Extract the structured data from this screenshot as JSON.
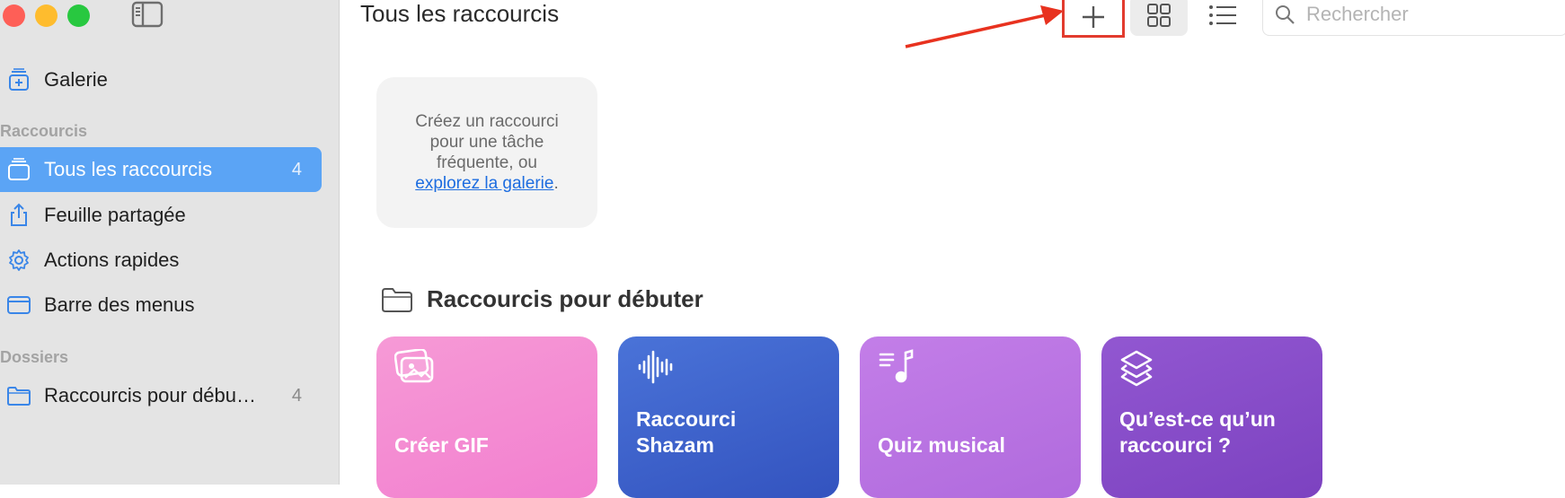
{
  "sidebar": {
    "gallery_label": "Galerie",
    "section_shortcuts": "Raccourcis",
    "section_folders": "Dossiers",
    "items": [
      {
        "label": "Tous les raccourcis",
        "count": "4"
      },
      {
        "label": "Feuille partagée",
        "count": ""
      },
      {
        "label": "Actions rapides",
        "count": ""
      },
      {
        "label": "Barre des menus",
        "count": ""
      }
    ],
    "folders": [
      {
        "label": "Raccourcis pour débu…",
        "count": "4"
      }
    ]
  },
  "header": {
    "title": "Tous les raccourcis",
    "search_placeholder": "Rechercher"
  },
  "empty_card": {
    "line1": "Créez un raccourci",
    "line2": "pour une tâche",
    "line3": "fréquente, ou",
    "link": "explorez la galerie",
    "suffix": "."
  },
  "starter_section": {
    "title": "Raccourcis pour débuter",
    "tiles": [
      {
        "name": "Créer GIF",
        "icon": "photos-icon"
      },
      {
        "name": "Raccourci\nShazam",
        "icon": "waveform-icon"
      },
      {
        "name": "Quiz musical",
        "icon": "music-list-icon"
      },
      {
        "name": "Qu’est-ce qu’un\nraccourci ?",
        "icon": "layers-icon"
      }
    ]
  },
  "colors": {
    "selected": "#5ba4f5",
    "highlight": "#e23b2e",
    "link": "#1d6de0",
    "tile_gif": "#f27fcf",
    "tile_shazam": "#3353bf",
    "tile_quiz": "#b06add",
    "tile_what": "#7c42c0"
  }
}
